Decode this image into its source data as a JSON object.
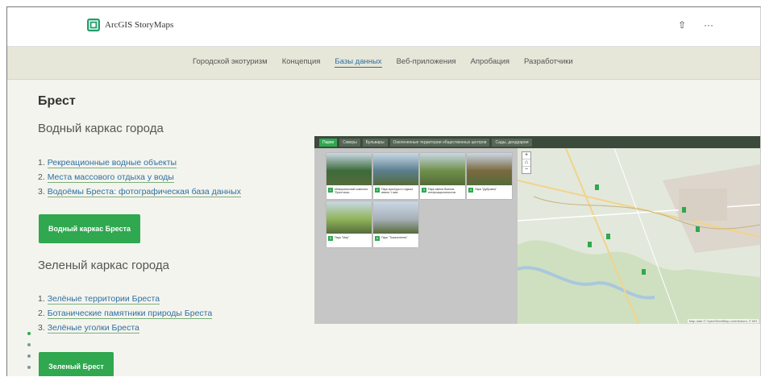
{
  "topbar": {
    "logo_text": "ArcGIS StoryMaps",
    "share_icon": "⇧",
    "more_icon": "···"
  },
  "nav": {
    "items": [
      {
        "label": "Городской экотуризм",
        "active": false
      },
      {
        "label": "Концепция",
        "active": false
      },
      {
        "label": "Базы данных",
        "active": true
      },
      {
        "label": "Веб-приложения",
        "active": false
      },
      {
        "label": "Апробация",
        "active": false
      },
      {
        "label": "Разработчики",
        "active": false
      }
    ]
  },
  "main": {
    "city_title": "Брест",
    "water": {
      "heading": "Водный каркас города",
      "links": [
        {
          "num": "1.",
          "text": "Рекреационные водные объекты"
        },
        {
          "num": "2.",
          "text": "Места массового отдыха у воды"
        },
        {
          "num": "3.",
          "text": "Водоёмы Бреста: фотографическая база данных"
        }
      ],
      "button": "Водный каркас Бреста"
    },
    "green": {
      "heading": "Зеленый каркас города",
      "links": [
        {
          "num": "1.",
          "text": "Зелёные территории Бреста"
        },
        {
          "num": "2.",
          "text": "Ботанические памятники природы Бреста"
        },
        {
          "num": "3.",
          "text": "Зелёные уголки Бреста"
        }
      ],
      "button": "Зеленый Брест"
    }
  },
  "app": {
    "tabs": [
      {
        "label": "Парки",
        "active": true
      },
      {
        "label": "Скверы",
        "active": false
      },
      {
        "label": "Бульвары",
        "active": false
      },
      {
        "label": "Озелененные территории общественных центров",
        "active": false
      },
      {
        "label": "Сады, дендрарии",
        "active": false
      }
    ],
    "cards": [
      {
        "num": "1",
        "caption": "Мемориальный комплекс \"Брестская...",
        "color": "#3d6b3a"
      },
      {
        "num": "2",
        "caption": "Парк культуры и отдыха имени 1 мая",
        "color": "#5a7f8f"
      },
      {
        "num": "3",
        "caption": "Парк имени Воинов-интернационалистов",
        "color": "#6f8f4a"
      },
      {
        "num": "4",
        "caption": "Парк \"Дубровка\"",
        "color": "#7a6a3f"
      },
      {
        "num": "5",
        "caption": "Парк \"Мир\"",
        "color": "#8fb55a"
      },
      {
        "num": "6",
        "caption": "Парк \"Тысячелетия\"",
        "color": "#a8b0b8"
      }
    ],
    "zoom_in": "+",
    "home": "⌂",
    "zoom_out": "−",
    "attribution": "Map data © OpenStreetMap contributors, © MS"
  }
}
